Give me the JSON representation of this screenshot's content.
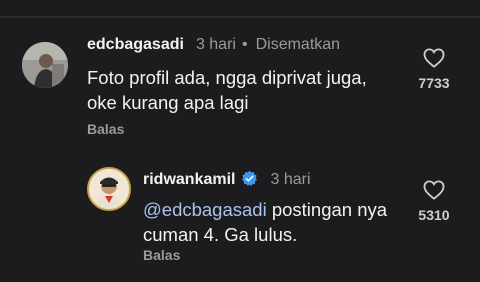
{
  "comments": [
    {
      "username": "edcbagasadi",
      "time": "3 hari",
      "pinned_label": "Disematkan",
      "text": "Foto profil ada, ngga diprivat juga, oke kurang apa lagi",
      "like_count": "7733",
      "reply_label": "Balas"
    },
    {
      "username": "ridwankamil",
      "verified": true,
      "time": "3 hari",
      "mention": "@edcbagasadi",
      "text": " postingan nya cuman 4. Ga lulus.",
      "like_count": "5310",
      "reply_label": "Balas"
    }
  ],
  "colors": {
    "background": "#1c1c1e",
    "mention": "#a7c3ee",
    "verified_badge": "#3897f0",
    "muted": "#9a9a9a"
  },
  "icons": [
    "heart-outline-icon",
    "verified-badge-icon"
  ]
}
